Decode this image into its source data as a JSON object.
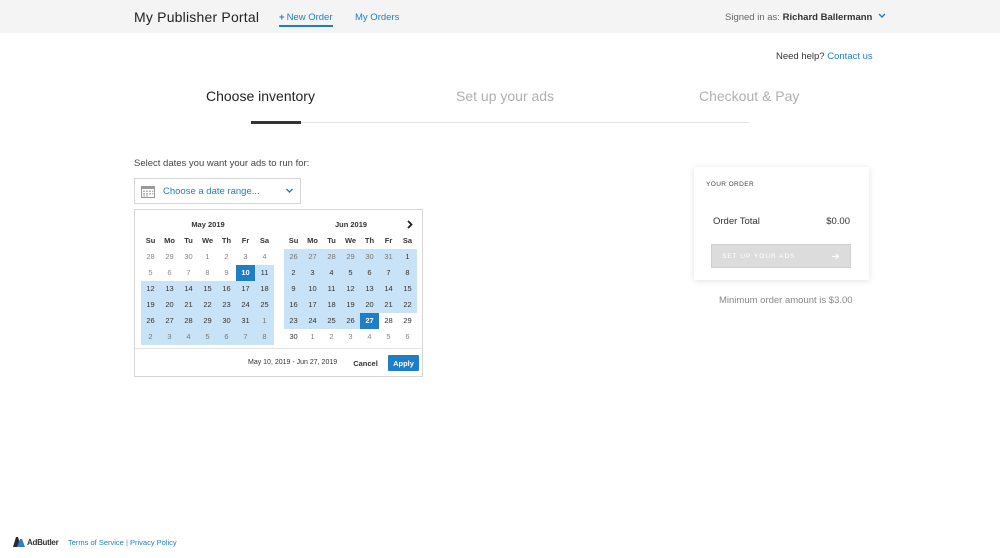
{
  "header": {
    "brand": "My Publisher Portal",
    "nav_new_order": "New Order",
    "nav_my_orders": "My Orders",
    "signed_in_prefix": "Signed in as:",
    "signed_in_user": "Richard Ballermann"
  },
  "help": {
    "text": "Need help?",
    "link": "Contact us"
  },
  "steps": [
    "Choose inventory",
    "Set up your ads",
    "Checkout & Pay"
  ],
  "dates": {
    "label": "Select dates you want your ads to run for:",
    "dropdown_text": "Choose a date range..."
  },
  "calendar": {
    "dow": [
      "Su",
      "Mo",
      "Tu",
      "We",
      "Th",
      "Fr",
      "Sa"
    ],
    "months": [
      {
        "title": "May 2019",
        "weeks": [
          [
            "28",
            "29",
            "30",
            "1",
            "2",
            "3",
            "4"
          ],
          [
            "5",
            "6",
            "7",
            "8",
            "9",
            "10",
            "11"
          ],
          [
            "12",
            "13",
            "14",
            "15",
            "16",
            "17",
            "18"
          ],
          [
            "19",
            "20",
            "21",
            "22",
            "23",
            "24",
            "25"
          ],
          [
            "26",
            "27",
            "28",
            "29",
            "30",
            "31",
            "1"
          ],
          [
            "2",
            "3",
            "4",
            "5",
            "6",
            "7",
            "8"
          ]
        ]
      },
      {
        "title": "Jun 2019",
        "weeks": [
          [
            "26",
            "27",
            "28",
            "29",
            "30",
            "31",
            "1"
          ],
          [
            "2",
            "3",
            "4",
            "5",
            "6",
            "7",
            "8"
          ],
          [
            "9",
            "10",
            "11",
            "12",
            "13",
            "14",
            "15"
          ],
          [
            "16",
            "17",
            "18",
            "19",
            "20",
            "21",
            "22"
          ],
          [
            "23",
            "24",
            "25",
            "26",
            "27",
            "28",
            "29"
          ],
          [
            "30",
            "1",
            "2",
            "3",
            "4",
            "5",
            "6"
          ]
        ]
      }
    ],
    "range_text": "May 10, 2019 - Jun 27, 2019",
    "cancel_label": "Cancel",
    "apply_label": "Apply"
  },
  "order": {
    "title": "Your Order",
    "total_label": "Order Total",
    "total_value": "$0.00",
    "button_label": "Set up your ads",
    "min_order": "Minimum order amount is $3.00"
  },
  "footer": {
    "logo_text": "AdButler",
    "terms": "Terms of Service",
    "separator": "|",
    "privacy": "Privacy Policy"
  },
  "colors": {
    "accent": "#1e7ec8",
    "range": "#c8e2f7"
  }
}
